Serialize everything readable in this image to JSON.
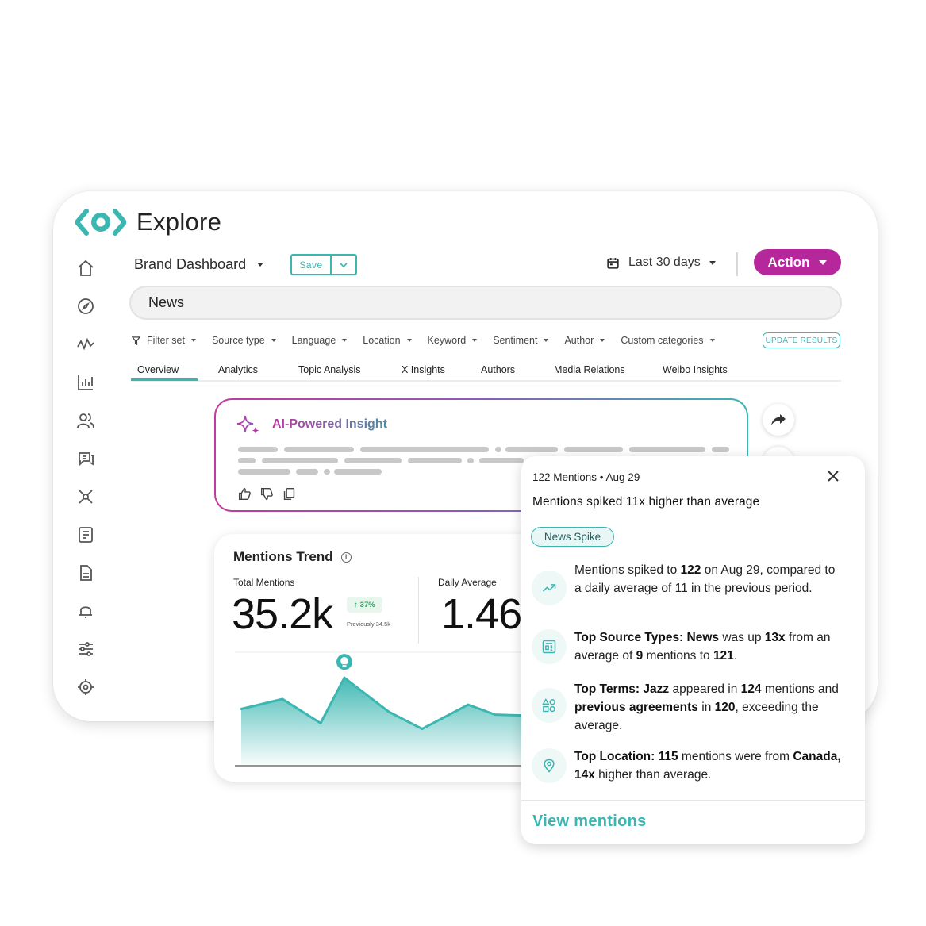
{
  "app": {
    "title": "Explore"
  },
  "header": {
    "dashboard_name": "Brand Dashboard",
    "save_label": "Save",
    "date_range": "Last 30 days",
    "action_label": "Action"
  },
  "search": {
    "value": "News"
  },
  "filters": {
    "items": [
      "Filter set",
      "Source type",
      "Language",
      "Location",
      "Keyword",
      "Sentiment",
      "Author",
      "Custom categories"
    ],
    "update_label": "UPDATE RESULTS"
  },
  "tabs": [
    "Overview",
    "Analytics",
    "Topic Analysis",
    "X Insights",
    "Authors",
    "Media Relations",
    "Weibo Insights"
  ],
  "ai_insight": {
    "title": "AI-Powered Insight"
  },
  "mentions_trend": {
    "title": "Mentions Trend",
    "total_label": "Total Mentions",
    "total_value": "35.2k",
    "change": "↑ 37%",
    "previous": "Previously 34.5k",
    "daily_label": "Daily Average",
    "daily_value": "1.46"
  },
  "popup": {
    "meta": "122 Mentions • Aug 29",
    "headline": "Mentions spiked 11x higher than average",
    "tag": "News Spike",
    "items": [
      {
        "icon": "trend-up-icon",
        "parts": [
          [
            "t",
            "Mentions spiked to "
          ],
          [
            "b",
            "122"
          ],
          [
            "t",
            " on Aug 29, compared to a daily average of 11 in the previous period."
          ]
        ]
      },
      {
        "icon": "newspaper-icon",
        "parts": [
          [
            "b",
            "Top Source Types: News"
          ],
          [
            "t",
            " was up "
          ],
          [
            "b",
            "13x"
          ],
          [
            "t",
            " from an average of "
          ],
          [
            "b",
            "9"
          ],
          [
            "t",
            " mentions to "
          ],
          [
            "b",
            "121"
          ],
          [
            "t",
            "."
          ]
        ]
      },
      {
        "icon": "shapes-icon",
        "parts": [
          [
            "b",
            "Top Terms: Jazz"
          ],
          [
            "t",
            " appeared in "
          ],
          [
            "b",
            "124"
          ],
          [
            "t",
            " mentions and "
          ],
          [
            "b",
            "previous agreements"
          ],
          [
            "t",
            " in "
          ],
          [
            "b",
            "120"
          ],
          [
            "t",
            ", exceeding the average."
          ]
        ]
      },
      {
        "icon": "location-pin-icon",
        "parts": [
          [
            "b",
            "Top Location: 115"
          ],
          [
            "t",
            " mentions were from "
          ],
          [
            "b",
            "Canada, 14x"
          ],
          [
            "t",
            " higher than average."
          ]
        ]
      }
    ],
    "view_label": "View mentions"
  },
  "colors": {
    "accent": "#3bb6b1",
    "action": "#b6279b"
  },
  "chart_data": {
    "type": "area",
    "x": [
      1,
      2,
      3,
      4,
      5,
      6,
      7,
      8,
      9
    ],
    "values": [
      40,
      47,
      30,
      62,
      38,
      26,
      43,
      36,
      35
    ],
    "ylim": [
      0,
      80
    ],
    "annotation": "lightbulb-icon at spike"
  }
}
